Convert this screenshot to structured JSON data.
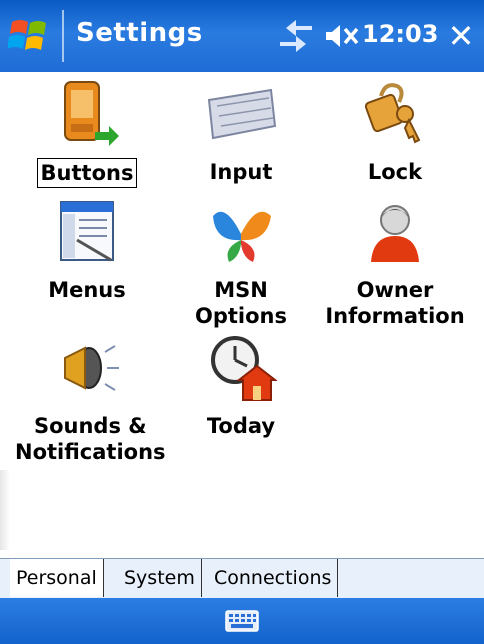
{
  "titlebar": {
    "title": "Settings",
    "clock": "12:03",
    "close_label": "✕",
    "start_icon": "windows-flag-icon",
    "connectivity_icon": "connectivity-icon",
    "volume_icon": "volume-muted-icon"
  },
  "items": [
    {
      "label": "Buttons",
      "icon": "buttons-icon",
      "selected": true
    },
    {
      "label": "Input",
      "icon": "keyboard-icon"
    },
    {
      "label": "Lock",
      "icon": "lock-icon"
    },
    {
      "label": "Menus",
      "icon": "menus-icon"
    },
    {
      "label": "MSN Options",
      "icon": "msn-butterfly-icon"
    },
    {
      "label": "Owner Information",
      "icon": "owner-icon"
    },
    {
      "label": "Sounds & Notifications",
      "icon": "speaker-icon"
    },
    {
      "label": "Today",
      "icon": "today-clock-home-icon"
    }
  ],
  "tabs": [
    {
      "label": "Personal",
      "active": true
    },
    {
      "label": "System"
    },
    {
      "label": "Connections"
    }
  ],
  "bottombar": {
    "input_icon": "keyboard-input-icon"
  },
  "colors": {
    "titlebar": "#1f6cd6",
    "bottombar": "#1c6fd8",
    "tabstrip": "#e8f0fb"
  }
}
